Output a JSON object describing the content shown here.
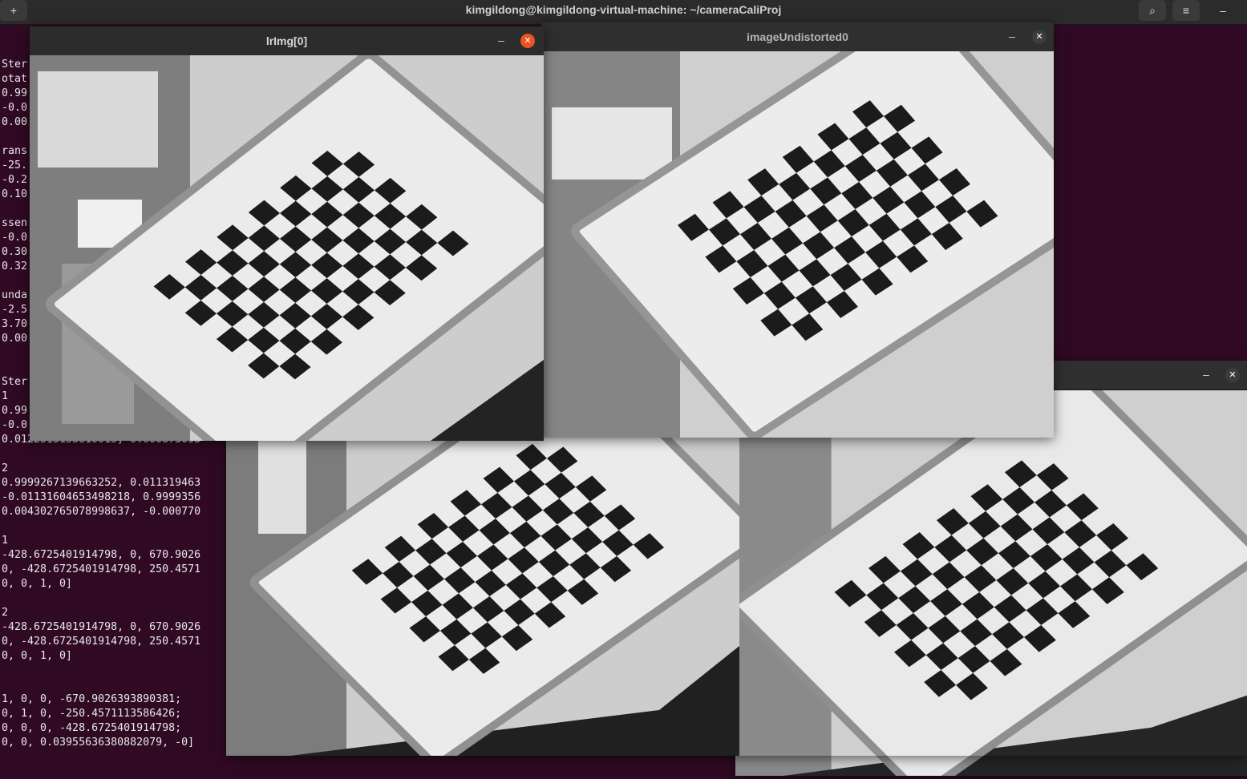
{
  "terminal": {
    "title": "kimgildong@kimgildong-virtual-machine: ~/cameraCaliProj",
    "lines": [
      "Ster",
      "otat",
      "0.99",
      "-0.0",
      "0.00",
      "",
      "rans",
      "-25.",
      "-0.2",
      "0.10",
      "",
      "ssen",
      "-0.0",
      "0.30",
      "0.32",
      "",
      "unda",
      "-2.5",
      "3.70",
      "0.00",
      "",
      "",
      "Ster",
      "1",
      "0.99",
      "-0.0",
      "0.0122515153810015, 0.000873093",
      "",
      "2",
      "0.9999267139663252, 0.011319463",
      "-0.01131604653498218, 0.9999356",
      "0.004302765078998637, -0.000770",
      "",
      "1",
      "-428.6725401914798, 0, 670.9026",
      "0, -428.6725401914798, 250.4571",
      "0, 0, 1, 0]",
      "",
      "2",
      "-428.6725401914798, 0, 670.9026",
      "0, -428.6725401914798, 250.4571",
      "0, 0, 1, 0]",
      "",
      "",
      "1, 0, 0, -670.9026393890381;",
      "0, 1, 0, -250.4571113586426;",
      "0, 0, 0, -428.6725401914798;",
      "0, 0, 0.03955636380882079, -0]"
    ]
  },
  "windows": {
    "lrimg": {
      "title": "lrImg[0]",
      "minimize": "–",
      "close": "✕"
    },
    "undistorted": {
      "title": "imageUndistorted0",
      "minimize": "–",
      "close": "✕"
    },
    "third": {
      "title": "",
      "minimize": "–",
      "close": "✕"
    },
    "fourth": {
      "title": ""
    }
  },
  "header_buttons": {
    "new_tab": "+",
    "search": "⌕",
    "menu": "≡",
    "minimize": "–"
  },
  "colors": {
    "terminal_bg": "#300a24",
    "close_active": "#e95420",
    "titlebar": "#2c2c2c"
  }
}
